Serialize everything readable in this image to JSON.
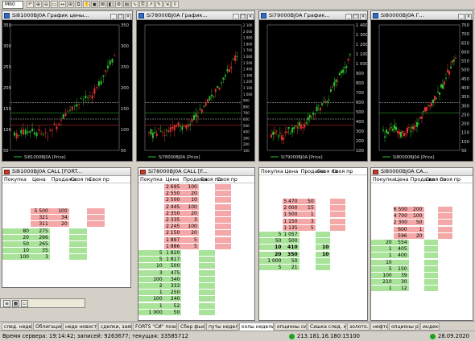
{
  "toolbar": {
    "timeframe": "M60",
    "buttons": [
      "↶",
      "⊕",
      "⊖",
      "▭",
      "↔",
      "⊞",
      "⧉",
      "✋",
      "▣",
      "⊠",
      "◧",
      "⚙",
      "▤",
      "∿",
      "⎘",
      "↗",
      "✎",
      "⇲",
      "⇳"
    ]
  },
  "charts": [
    {
      "title": "Si81000BJ0A График цены...",
      "legend": "Si81000BJ0A [Price]",
      "yticks": [
        "350",
        "300",
        "250",
        "200",
        "150",
        "100",
        "50"
      ]
    },
    {
      "title": "Si78000BJ0A График...",
      "legend": "Si78000BJ0A [Price]",
      "yticks": [
        "2 100",
        "2 000",
        "1 900",
        "1 800",
        "1 700",
        "1 600",
        "1 500",
        "1 400",
        "1 300",
        "1 200",
        "1 100",
        "1 000",
        "900",
        "800",
        "700",
        "600",
        "500",
        "400",
        "300",
        "200",
        "100"
      ]
    },
    {
      "title": "Si79000BJ0A График...",
      "legend": "Si79000BJ0A [Price]",
      "yticks": [
        "1 400",
        "1 300",
        "1 200",
        "1 100",
        "1 000",
        "900",
        "800",
        "700",
        "600",
        "500",
        "400",
        "300",
        "200",
        "100"
      ]
    },
    {
      "title": "Si80000BJ0A Г...",
      "legend": "Si80000BJ0A [Price]",
      "yticks": [
        "750",
        "700",
        "650",
        "600",
        "550",
        "500",
        "450",
        "400",
        "350",
        "300",
        "250",
        "200",
        "150",
        "100",
        "50"
      ]
    }
  ],
  "depths": [
    {
      "title": "Si81000BJ0A CALL [FORT...",
      "headers": [
        "Покупка",
        "Цена",
        "Продажа",
        "Своя по",
        "Своя пр"
      ],
      "rows": [
        {
          "buy": "",
          "price": "5 500",
          "sell": "100",
          "own": "",
          "ownp": "",
          "side": "ask"
        },
        {
          "buy": "",
          "price": "321",
          "sell": "34",
          "own": "",
          "ownp": "",
          "side": "ask"
        },
        {
          "buy": "",
          "price": "311",
          "sell": "20",
          "own": "",
          "ownp": "",
          "side": "ask"
        },
        {
          "buy": "80",
          "price": "275",
          "sell": "",
          "own": "",
          "ownp": "",
          "side": "bid"
        },
        {
          "buy": "20",
          "price": "266",
          "sell": "",
          "own": "",
          "ownp": "",
          "side": "bid"
        },
        {
          "buy": "50",
          "price": "265",
          "sell": "",
          "own": "",
          "ownp": "",
          "side": "bid"
        },
        {
          "buy": "10",
          "price": "35",
          "sell": "",
          "own": "",
          "ownp": "",
          "side": "bid"
        },
        {
          "buy": "100",
          "price": "3",
          "sell": "",
          "own": "",
          "ownp": "",
          "side": "bid"
        }
      ]
    },
    {
      "title": "Si78000BJ0A CALL [F...",
      "headers": [
        "Покупка",
        "Цена",
        "Продажа",
        "Своя по",
        "Своя пр"
      ],
      "rows": [
        {
          "buy": "",
          "price": "2 695",
          "sell": "100",
          "own": "",
          "ownp": "",
          "side": "ask"
        },
        {
          "buy": "",
          "price": "2 550",
          "sell": "20",
          "own": "",
          "ownp": "",
          "side": "ask"
        },
        {
          "buy": "",
          "price": "2 500",
          "sell": "10",
          "own": "",
          "ownp": "",
          "side": "ask"
        },
        {
          "buy": "",
          "price": "2 445",
          "sell": "100",
          "own": "",
          "ownp": "",
          "side": "ask"
        },
        {
          "buy": "",
          "price": "2 350",
          "sell": "20",
          "own": "",
          "ownp": "",
          "side": "ask"
        },
        {
          "buy": "",
          "price": "2 335",
          "sell": "3",
          "own": "",
          "ownp": "",
          "side": "ask"
        },
        {
          "buy": "",
          "price": "2 245",
          "sell": "100",
          "own": "",
          "ownp": "",
          "side": "ask"
        },
        {
          "buy": "",
          "price": "2 150",
          "sell": "20",
          "own": "",
          "ownp": "",
          "side": "ask"
        },
        {
          "buy": "",
          "price": "1 897",
          "sell": "5",
          "own": "",
          "ownp": "",
          "side": "ask"
        },
        {
          "buy": "",
          "price": "1 886",
          "sell": "5",
          "own": "",
          "ownp": "",
          "side": "ask"
        },
        {
          "buy": "5",
          "price": "1 820",
          "sell": "",
          "own": "",
          "ownp": "",
          "side": "bid"
        },
        {
          "buy": "5",
          "price": "1 817",
          "sell": "",
          "own": "",
          "ownp": "",
          "side": "bid"
        },
        {
          "buy": "10",
          "price": "500",
          "sell": "",
          "own": "",
          "ownp": "",
          "side": "bid"
        },
        {
          "buy": "3",
          "price": "475",
          "sell": "",
          "own": "",
          "ownp": "",
          "side": "bid"
        },
        {
          "buy": "100",
          "price": "340",
          "sell": "",
          "own": "",
          "ownp": "",
          "side": "bid"
        },
        {
          "buy": "2",
          "price": "333",
          "sell": "",
          "own": "",
          "ownp": "",
          "side": "bid"
        },
        {
          "buy": "1",
          "price": "250",
          "sell": "",
          "own": "",
          "ownp": "",
          "side": "bid"
        },
        {
          "buy": "100",
          "price": "240",
          "sell": "",
          "own": "",
          "ownp": "",
          "side": "bid"
        },
        {
          "buy": "1",
          "price": "52",
          "sell": "",
          "own": "",
          "ownp": "",
          "side": "bid"
        },
        {
          "buy": "1 000",
          "price": "50",
          "sell": "",
          "own": "",
          "ownp": "",
          "side": "bid"
        }
      ]
    },
    {
      "title": "",
      "headers": [
        "Покупка",
        "Цена",
        "Продажа",
        "Своя по",
        "Своя пр"
      ],
      "rows": [
        {
          "buy": "",
          "price": "5 470",
          "sell": "50",
          "own": "",
          "ownp": "",
          "side": "ask"
        },
        {
          "buy": "",
          "price": "2 000",
          "sell": "15",
          "own": "",
          "ownp": "",
          "side": "ask"
        },
        {
          "buy": "",
          "price": "1 500",
          "sell": "1",
          "own": "",
          "ownp": "",
          "side": "ask"
        },
        {
          "buy": "",
          "price": "1 150",
          "sell": "3",
          "own": "",
          "ownp": "",
          "side": "ask"
        },
        {
          "buy": "",
          "price": "1 135",
          "sell": "5",
          "own": "",
          "ownp": "",
          "side": "ask"
        },
        {
          "buy": "5",
          "price": "1 057",
          "sell": "",
          "own": "",
          "ownp": "",
          "side": "bid"
        },
        {
          "buy": "50",
          "price": "500",
          "sell": "",
          "own": "",
          "ownp": "",
          "side": "bid"
        },
        {
          "buy": "10",
          "price": "410",
          "sell": "",
          "own": "10",
          "ownp": "",
          "side": "bid",
          "bold": true
        },
        {
          "buy": "20",
          "price": "350",
          "sell": "",
          "own": "10",
          "ownp": "",
          "side": "bid",
          "bold": true
        },
        {
          "buy": "1 000",
          "price": "50",
          "sell": "",
          "own": "",
          "ownp": "",
          "side": "bid"
        },
        {
          "buy": "5",
          "price": "21",
          "sell": "",
          "own": "",
          "ownp": "",
          "side": "bid"
        }
      ]
    },
    {
      "title": "Si80000BJ0A CA...",
      "headers": [
        "Покупка",
        "Цена",
        "Продажа",
        "Своя по",
        "Своя пр"
      ],
      "rows": [
        {
          "buy": "",
          "price": "6 500",
          "sell": "200",
          "own": "",
          "ownp": "",
          "side": "ask"
        },
        {
          "buy": "",
          "price": "4 700",
          "sell": "100",
          "own": "",
          "ownp": "",
          "side": "ask"
        },
        {
          "buy": "",
          "price": "2 300",
          "sell": "50",
          "own": "",
          "ownp": "",
          "side": "ask"
        },
        {
          "buy": "",
          "price": "600",
          "sell": "1",
          "own": "",
          "ownp": "",
          "side": "ask"
        },
        {
          "buy": "",
          "price": "596",
          "sell": "20",
          "own": "",
          "ownp": "",
          "side": "ask"
        },
        {
          "buy": "20",
          "price": "554",
          "sell": "",
          "own": "",
          "ownp": "",
          "side": "bid"
        },
        {
          "buy": "1",
          "price": "405",
          "sell": "",
          "own": "",
          "ownp": "",
          "side": "bid"
        },
        {
          "buy": "1",
          "price": "400",
          "sell": "",
          "own": "",
          "ownp": "",
          "side": "bid"
        },
        {
          "buy": "10",
          "price": "",
          "sell": "",
          "own": "",
          "ownp": "",
          "side": "bid"
        },
        {
          "buy": "5",
          "price": "150",
          "sell": "",
          "own": "",
          "ownp": "",
          "side": "bid"
        },
        {
          "buy": "100",
          "price": "39",
          "sell": "",
          "own": "",
          "ownp": "",
          "side": "bid"
        },
        {
          "buy": "210",
          "price": "30",
          "sell": "",
          "own": "",
          "ownp": "",
          "side": "bid"
        },
        {
          "buy": "1",
          "price": "12",
          "sell": "",
          "own": "",
          "ownp": "",
          "side": "bid"
        }
      ]
    }
  ],
  "tabs": [
    "след. неделя",
    "Облигации",
    "неде новости",
    "сделки, заявки",
    "FORTS \"СИ\" позици...",
    "Сбер фьючи",
    "путы неделька",
    "колы неделька",
    "опционы сишка",
    "Сишка след. квартал",
    "золото..",
    "нефть",
    "опционы ртс",
    "индекс"
  ],
  "active_tab": 7,
  "status": {
    "server_time": "Время сервера: 19:14:42; записей: 9263677; текущая: 33585712",
    "connection": "213.181.16.180:15100",
    "date": "28.09.2020"
  },
  "colors": {
    "ask": "#f4a9a8",
    "bid": "#a9e39a",
    "candle_up": "#2fbf2f",
    "candle_down": "#e03030"
  }
}
